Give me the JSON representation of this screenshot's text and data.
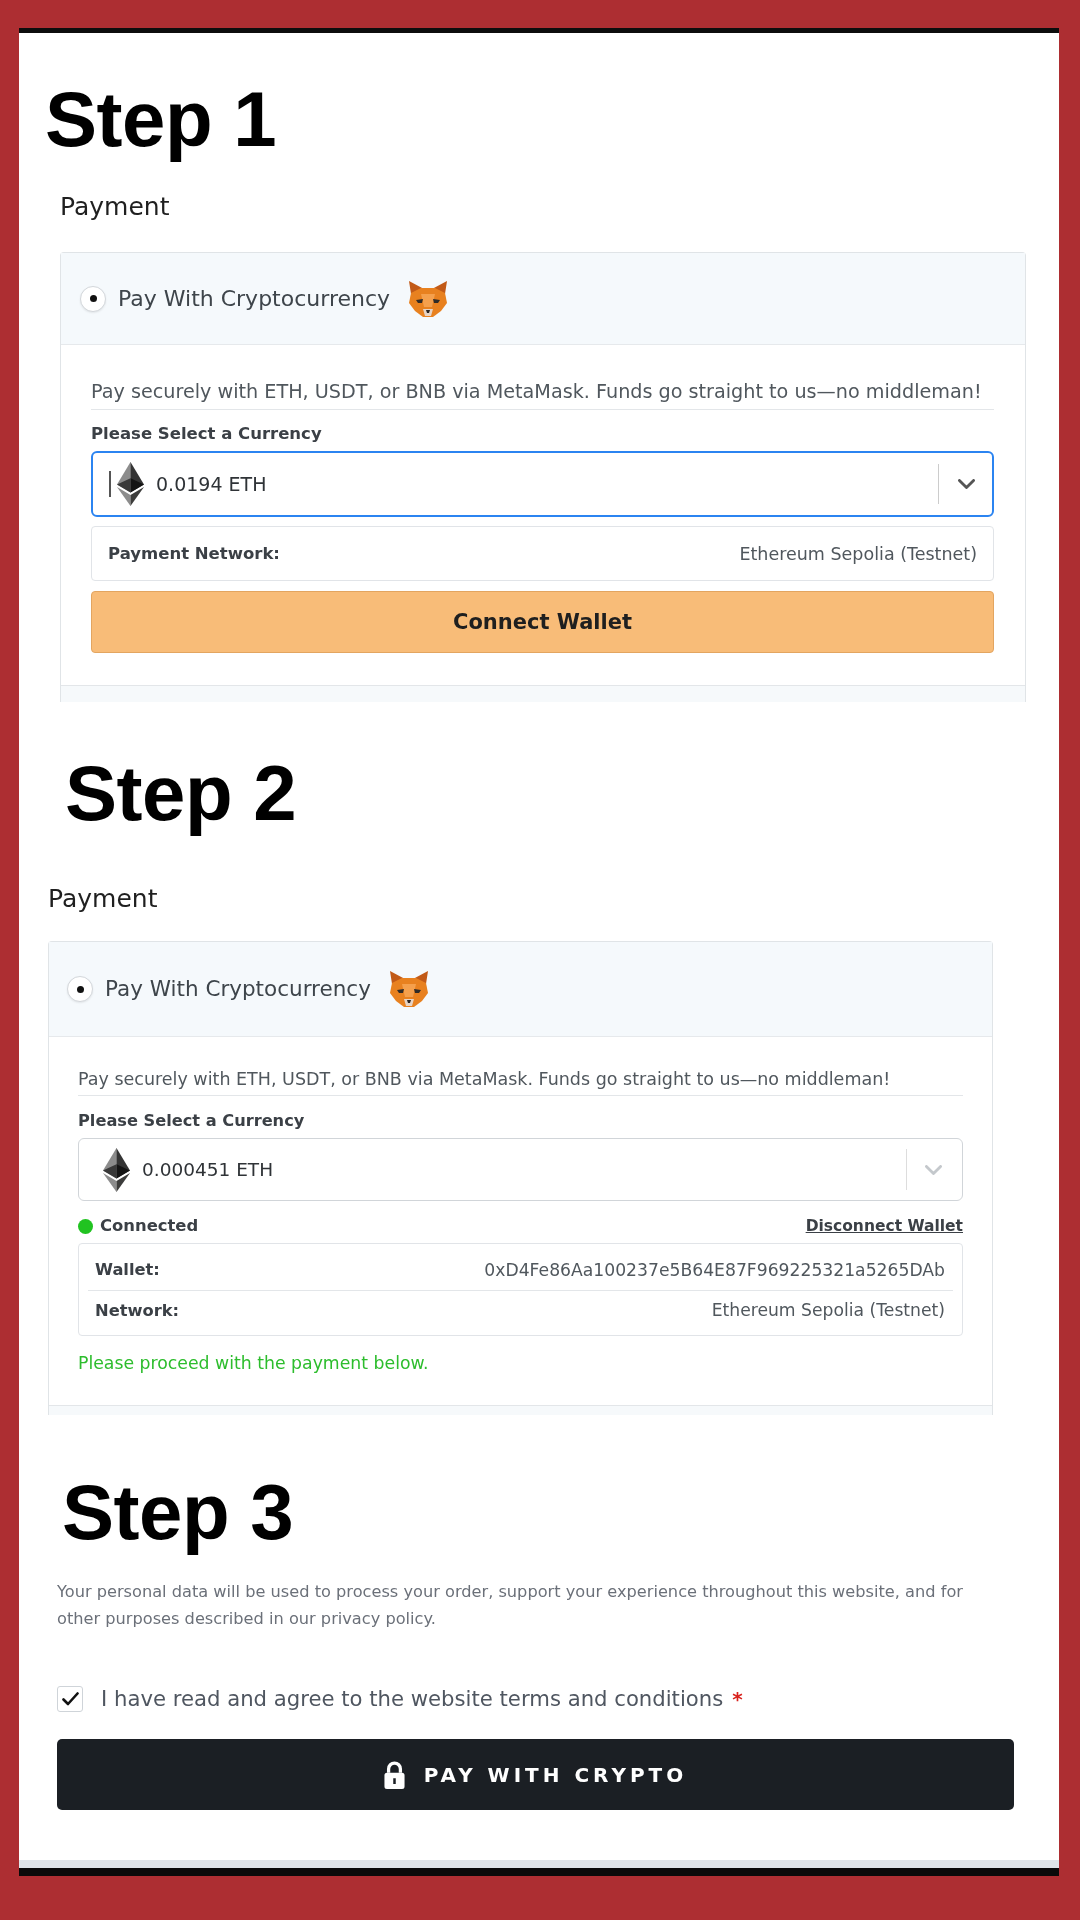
{
  "steps": [
    {
      "kind": "connect",
      "heading": "Step 1",
      "section_title": "Payment",
      "method": {
        "label": "Pay With Cryptocurrency",
        "selected": true
      },
      "description": "Pay securely with ETH, USDT, or BNB via MetaMask. Funds go straight to us—no middleman!",
      "currency_label": "Please Select a Currency",
      "currency": {
        "value": "0.0194 ETH",
        "focused": true,
        "disabled": false
      },
      "network": {
        "label": "Payment Network:",
        "value": "Ethereum Sepolia (Testnet)"
      },
      "connect_button": "Connect Wallet"
    },
    {
      "kind": "connected",
      "heading": "Step 2",
      "section_title": "Payment",
      "method": {
        "label": "Pay With Cryptocurrency",
        "selected": true
      },
      "description": "Pay securely with ETH, USDT, or BNB via MetaMask. Funds go straight to us—no middleman!",
      "currency_label": "Please Select a Currency",
      "currency": {
        "value": "0.000451 ETH",
        "focused": false,
        "disabled": true
      },
      "status": {
        "label": "Connected",
        "connected": true
      },
      "disconnect_link": "Disconnect Wallet",
      "details": [
        {
          "label": "Wallet:",
          "value": "0xD4Fe86Aa100237e5B64E87F969225321a5265DAb"
        },
        {
          "label": "Network:",
          "value": "Ethereum Sepolia (Testnet)"
        }
      ],
      "notice": "Please proceed with the payment below."
    },
    {
      "kind": "confirm",
      "heading": "Step 3",
      "privacy_text": "Your personal data will be used to process your order, support your experience throughout this website, and for other purposes described in our privacy policy.",
      "terms": {
        "label": "I have read and agree to the website terms and conditions",
        "required_mark": "*",
        "checked": true
      },
      "pay_button": "PAY WITH CRYPTO"
    }
  ]
}
